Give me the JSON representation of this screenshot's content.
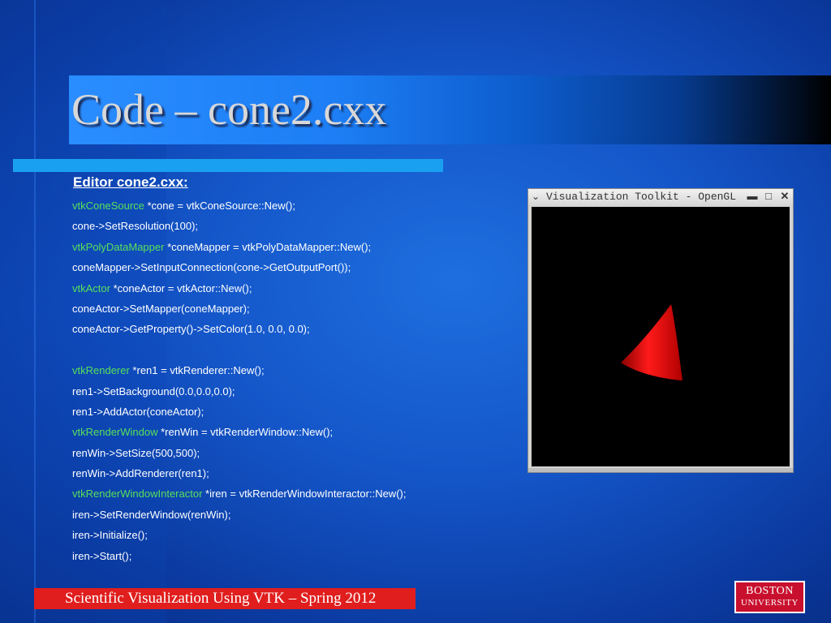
{
  "slide": {
    "title": "Code – cone2.cxx",
    "editor_heading": "Editor cone2.cxx:",
    "code_lines": [
      {
        "type": "vtkConeSource",
        "rest": " *cone = vtkConeSource::New();"
      },
      {
        "type": "",
        "rest": "cone->SetResolution(100);"
      },
      {
        "type": "vtkPolyDataMapper",
        "rest": " *coneMapper = vtkPolyDataMapper::New();"
      },
      {
        "type": "",
        "rest": "coneMapper->SetInputConnection(cone->GetOutputPort());"
      },
      {
        "type": "vtkActor",
        "rest": " *coneActor = vtkActor::New();"
      },
      {
        "type": "",
        "rest": "coneActor->SetMapper(coneMapper);"
      },
      {
        "type": "",
        "rest": "coneActor->GetProperty()->SetColor(1.0, 0.0, 0.0);"
      },
      {
        "type": "",
        "rest": ""
      },
      {
        "type": "vtkRenderer",
        "rest": " *ren1 = vtkRenderer::New();"
      },
      {
        "type": "",
        "rest": "ren1->SetBackground(0.0,0.0,0.0);"
      },
      {
        "type": "",
        "rest": "ren1->AddActor(coneActor);"
      },
      {
        "type": "vtkRenderWindow",
        "rest": " *renWin = vtkRenderWindow::New();"
      },
      {
        "type": "",
        "rest": "renWin->SetSize(500,500);"
      },
      {
        "type": "",
        "rest": "renWin->AddRenderer(ren1);"
      },
      {
        "type": "vtkRenderWindowInteractor",
        "rest": " *iren = vtkRenderWindowInteractor::New();"
      },
      {
        "type": "",
        "rest": "iren->SetRenderWindow(renWin);"
      },
      {
        "type": "",
        "rest": "iren->Initialize();"
      },
      {
        "type": "",
        "rest": "iren->Start();"
      }
    ],
    "footer": "Scientific Visualization Using VTK – Spring 2012"
  },
  "vtk_window": {
    "title": "Visualization Toolkit - OpenGL",
    "menu_icon": "chevron-down-icon",
    "buttons": [
      "minimize-icon",
      "maximize-icon",
      "close-icon"
    ],
    "render_background": "#000000",
    "cone_color": "#e00000"
  },
  "logo": {
    "line1": "BOSTON",
    "line2": "UNIVERSITY"
  },
  "colors": {
    "type_keyword": "#57e05a",
    "footer_bar": "#e01e1e",
    "title_bar_start": "#2a8dff"
  }
}
